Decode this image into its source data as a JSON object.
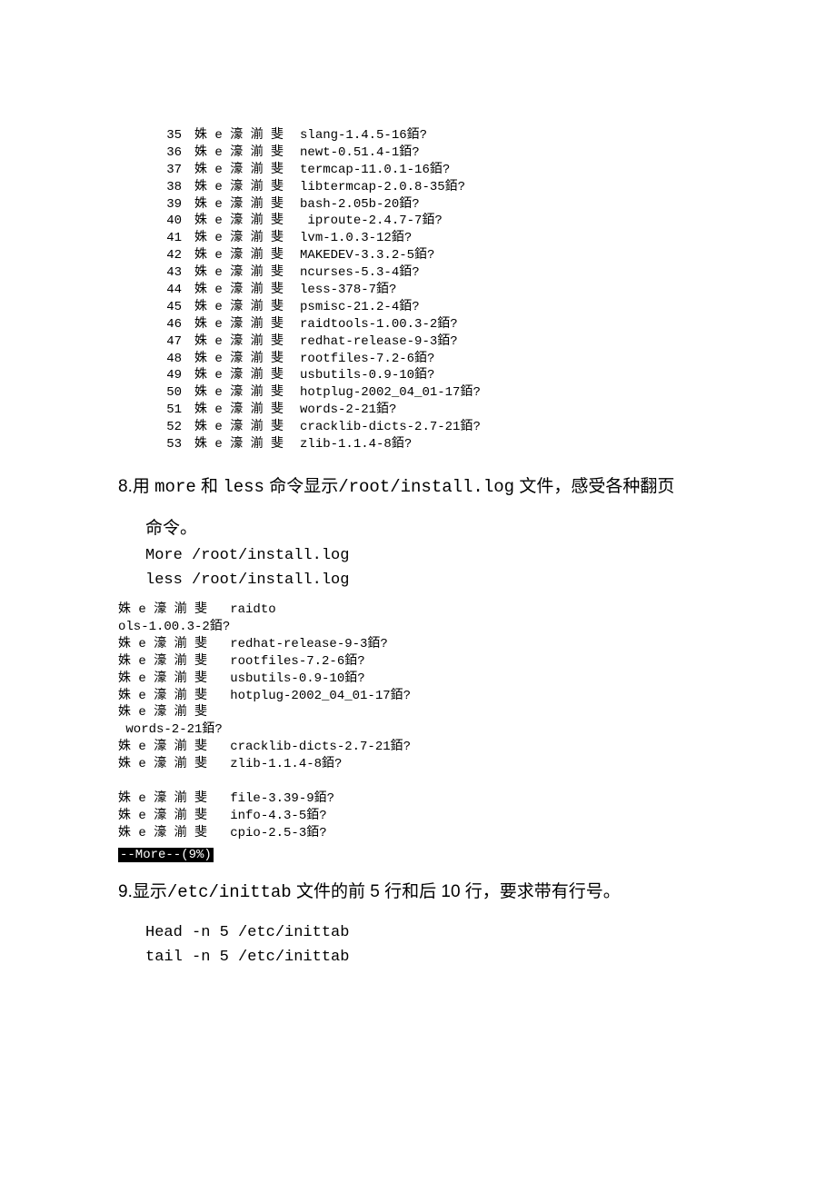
{
  "block1_prefix": "姝 e 濠 湔 斐",
  "block1_rows": [
    {
      "n": "35",
      "v": "slang-1.4.5-16銆?"
    },
    {
      "n": "36",
      "v": "newt-0.51.4-1銆?"
    },
    {
      "n": "37",
      "v": "termcap-11.0.1-16銆?"
    },
    {
      "n": "38",
      "v": "libtermcap-2.0.8-35銆?"
    },
    {
      "n": "39",
      "v": "bash-2.05b-20銆?"
    },
    {
      "n": "40",
      "v": " iproute-2.4.7-7銆?"
    },
    {
      "n": "41",
      "v": "lvm-1.0.3-12銆?"
    },
    {
      "n": "42",
      "v": "MAKEDEV-3.3.2-5銆?"
    },
    {
      "n": "43",
      "v": "ncurses-5.3-4銆?"
    },
    {
      "n": "44",
      "v": "less-378-7銆?"
    },
    {
      "n": "45",
      "v": "psmisc-21.2-4銆?"
    },
    {
      "n": "46",
      "v": "raidtools-1.00.3-2銆?"
    },
    {
      "n": "47",
      "v": "redhat-release-9-3銆?"
    },
    {
      "n": "48",
      "v": "rootfiles-7.2-6銆?"
    },
    {
      "n": "49",
      "v": "usbutils-0.9-10銆?"
    },
    {
      "n": "50",
      "v": "hotplug-2002_04_01-17銆?"
    },
    {
      "n": "51",
      "v": "words-2-21銆?"
    },
    {
      "n": "52",
      "v": "cracklib-dicts-2.7-21銆?"
    },
    {
      "n": "53",
      "v": "zlib-1.1.4-8銆?"
    }
  ],
  "q8_num": "8.",
  "q8_a": "用 ",
  "q8_more": "more",
  "q8_b": " 和 ",
  "q8_less": "less",
  "q8_c": " 命令显示",
  "q8_path": "/root/install.log",
  "q8_d": " 文件，感受各种翻页",
  "q8_e": "命令。",
  "q8_cmd1": "More /root/install.log",
  "q8_cmd2": "less /root/install.log",
  "block2_lines": [
    "姝 e 濠 湔 斐   raidto",
    "ols-1.00.3-2銆?",
    "姝 e 濠 湔 斐   redhat-release-9-3銆?",
    "姝 e 濠 湔 斐   rootfiles-7.2-6銆?",
    "姝 e 濠 湔 斐   usbutils-0.9-10銆?",
    "姝 e 濠 湔 斐   hotplug-2002_04_01-17銆?",
    "姝 e 濠 湔 斐",
    " words-2-21銆?",
    "姝 e 濠 湔 斐   cracklib-dicts-2.7-21銆?",
    "姝 e 濠 湔 斐   zlib-1.1.4-8銆?",
    "",
    "姝 e 濠 湔 斐   file-3.39-9銆?",
    "姝 e 濠 湔 斐   info-4.3-5銆?",
    "姝 e 濠 湔 斐   cpio-2.5-3銆?"
  ],
  "more_bar": "--More--(9%)",
  "q9_num": "9.",
  "q9_a": "显示",
  "q9_path": "/etc/inittab",
  "q9_b": " 文件的前 5 行和后 10 行，要求带有行号。",
  "q9_cmd1": "Head -n 5 /etc/inittab",
  "q9_cmd2": "tail -n 5 /etc/inittab"
}
